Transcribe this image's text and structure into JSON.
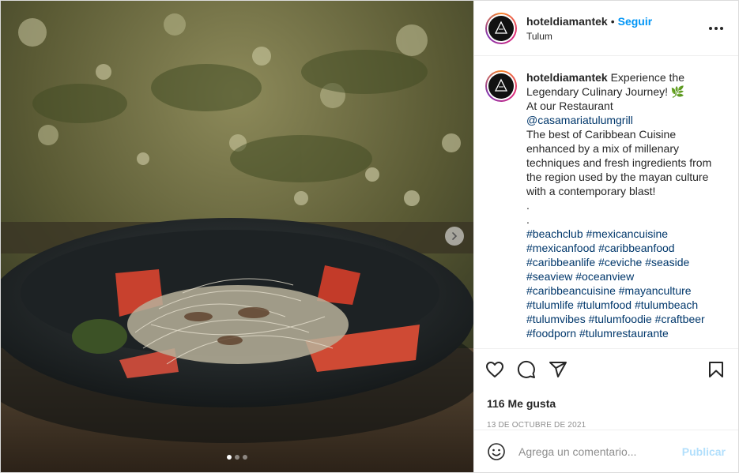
{
  "post": {
    "username": "hoteldiamantek",
    "follow_label": "Seguir",
    "location": "Tulum",
    "more_icon": "more-options-icon"
  },
  "caption": {
    "username": "hoteldiamantek",
    "line1": "Experience the Legendary Culinary Journey! 🌿",
    "line2": "At our Restaurant",
    "mention": "@casamariatulumgrill",
    "line3": "The best of Caribbean Cuisine enhanced by a mix of millenary techniques and fresh ingredients from the region used by the mayan culture with a contemporary blast!",
    "dot1": ".",
    "dot2": ".",
    "hashtags": [
      "#beachclub",
      "#mexicancuisine",
      "#mexicanfood",
      "#caribbeanfood",
      "#caribbeanlife",
      "#ceviche",
      "#seaside",
      "#seaview",
      "#oceanview",
      "#caribbeancuisine",
      "#mayanculture",
      "#tulumlife",
      "#tulumfood",
      "#tulumbeach",
      "#tulumvibes",
      "#tulumfoodie",
      "#craftbeer",
      "#foodporn",
      "#tulumrestaurante"
    ]
  },
  "actions": {
    "icons": [
      "heart-icon",
      "comment-icon",
      "share-icon",
      "bookmark-icon"
    ]
  },
  "likes_label": "116 Me gusta",
  "date_label": "13 DE OCTUBRE DE 2021",
  "comment": {
    "placeholder": "Agrega un comentario...",
    "publish_label": "Publicar"
  },
  "carousel": {
    "count": 3,
    "active_index": 0
  },
  "colors": {
    "accent": "#0095f6",
    "publish_disabled": "#b2dffc",
    "link": "#00376b"
  }
}
